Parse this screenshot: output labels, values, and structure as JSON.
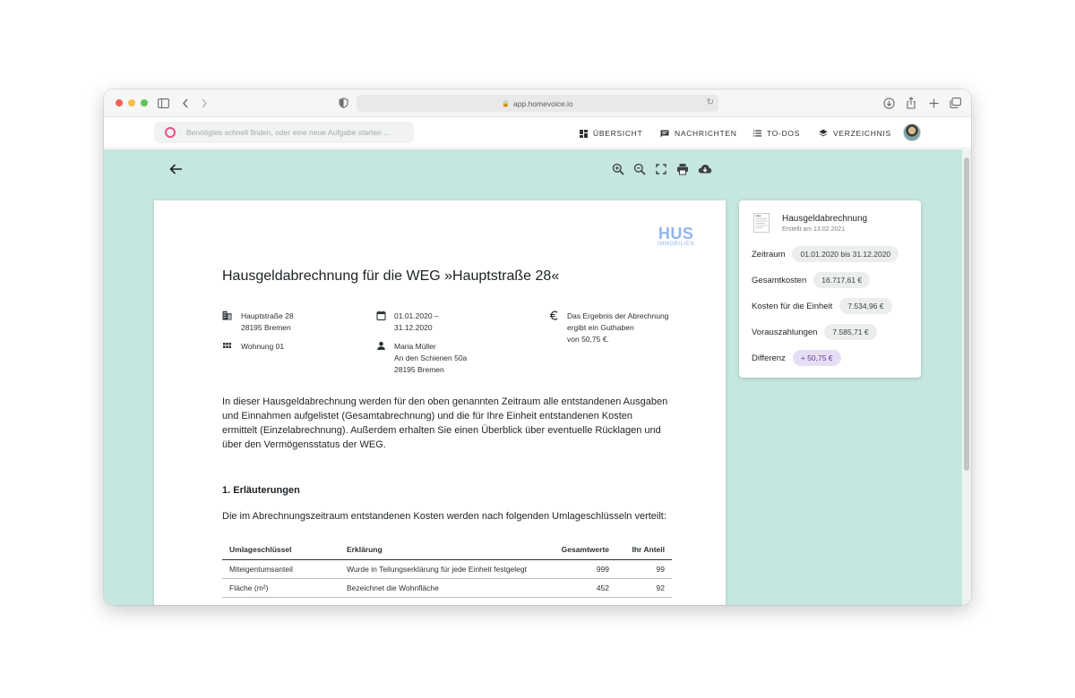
{
  "browser": {
    "url": "app.homevoice.io"
  },
  "appbar": {
    "search_placeholder": "Benötigtes schnell finden, oder eine neue Aufgabe starten ...",
    "nav": [
      {
        "label": "ÜBERSICHT",
        "icon": "dashboard-icon"
      },
      {
        "label": "NACHRICHTEN",
        "icon": "message-icon"
      },
      {
        "label": "TO-DOS",
        "icon": "list-icon"
      },
      {
        "label": "VERZEICHNIS",
        "icon": "layers-icon"
      }
    ]
  },
  "viewer": {
    "tools": [
      "zoom-in-icon",
      "zoom-out-icon",
      "fullscreen-icon",
      "print-icon",
      "download-icon"
    ]
  },
  "document": {
    "logo_main": "HUS",
    "logo_sub": "IMMOBILIEN",
    "title": "Hausgeldabrechnung für die WEG »Hauptstraße 28«",
    "address_line1": "Hauptstraße 28",
    "address_line2": "28195 Bremen",
    "unit": "Wohnung 01",
    "period_line1": "01.01.2020 –",
    "period_line2": "31.12.2020",
    "owner_name": "Maria Müller",
    "owner_street": "An den Schienen 50a",
    "owner_city": "28195 Bremen",
    "result_line1": "Das Ergebnis der Abrechnung",
    "result_line2": "ergibt ein Guthaben",
    "result_line3": "von 50,75 €.",
    "intro": "In dieser Hausgeldabrechnung werden für den oben genannten Zeitraum alle entstandenen Ausgaben und Einnahmen aufgelistet (Gesamtabrechnung) und die für Ihre Einheit entstandenen Kosten ermittelt (Einzelabrechnung). Außerdem erhalten Sie einen Überblick über eventuelle Rücklagen und über den Vermögensstatus der WEG.",
    "section1_title": "1. Erläuterungen",
    "section1_text": "Die im Abrechnungszeitraum entstandenen Kosten werden nach folgenden Umlageschlüsseln verteilt:",
    "table": {
      "headers": [
        "Umlageschlüssel",
        "Erklärung",
        "Gesamtwerte",
        "Ihr Anteil"
      ],
      "rows": [
        [
          "Miteigentumsanteil",
          "Wurde in Teilungserklärung für jede Einheit festgelegt",
          "999",
          "99"
        ],
        [
          "Fläche (m²)",
          "Bezeichnet die Wohnfläche",
          "452",
          "92"
        ]
      ]
    }
  },
  "summary": {
    "title": "Hausgeldabrechnung",
    "subtitle": "Erstellt am 13.02.2021",
    "rows": [
      {
        "label": "Zeitraum",
        "value": "01.01.2020 bis 31.12.2020"
      },
      {
        "label": "Gesamtkosten",
        "value": "16.717,61 €"
      },
      {
        "label": "Kosten für die Einheit",
        "value": "7.534,96 €"
      },
      {
        "label": "Vorauszahlungen",
        "value": "7.585,71 €"
      },
      {
        "label": "Differenz",
        "value": "+ 50,75 €"
      }
    ],
    "accent_color": "#e7def6"
  }
}
